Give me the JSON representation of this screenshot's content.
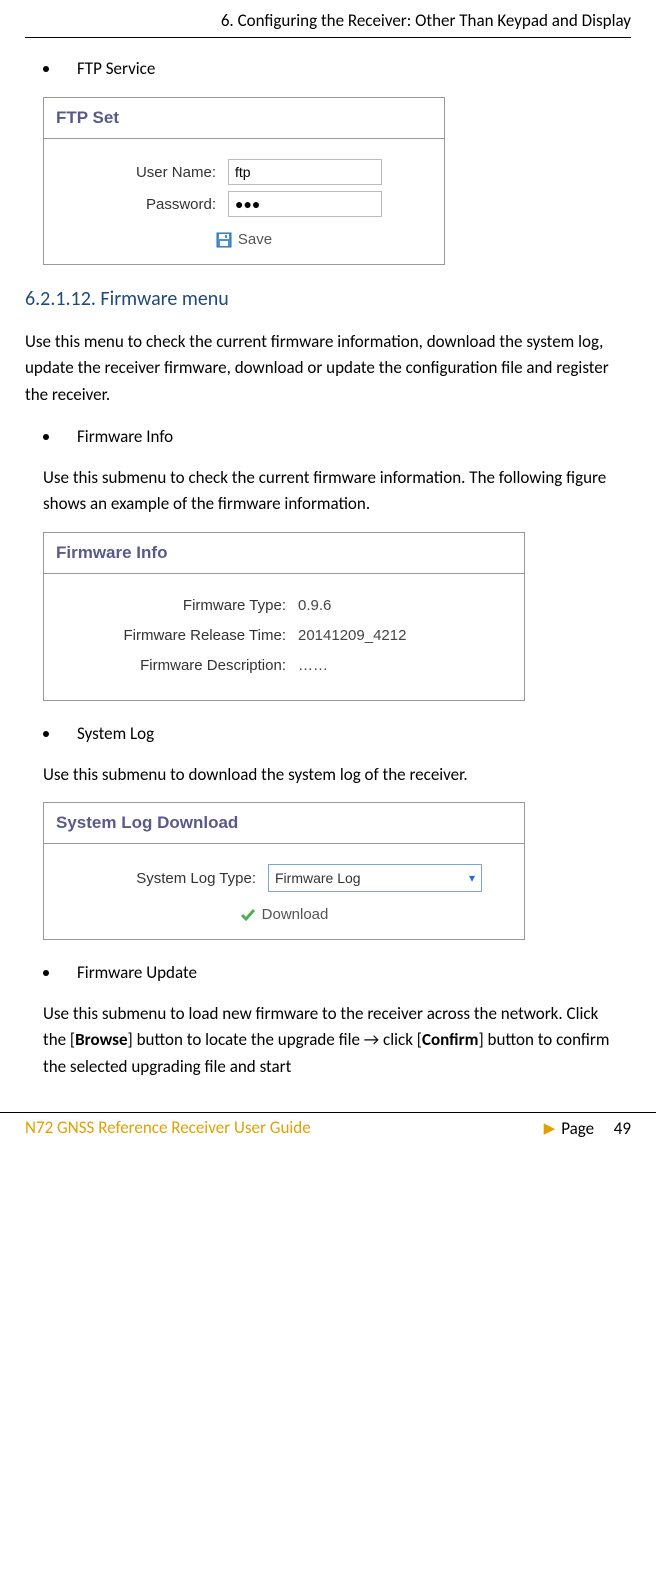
{
  "header": {
    "title": "6. Configuring the Receiver: Other Than Keypad and Display"
  },
  "bullets": {
    "ftp_service": "FTP Service",
    "firmware_info": "Firmware Info",
    "system_log": "System Log",
    "firmware_update": "Firmware Update"
  },
  "ftp_panel": {
    "title": "FTP Set",
    "username_label": "User Name:",
    "username_value": "ftp",
    "password_label": "Password:",
    "password_value": "●●●",
    "save_label": "Save"
  },
  "section_612": {
    "number": "6.2.1.12.",
    "title": "Firmware menu",
    "desc": "Use this menu to check the current firmware information, download the system log, update the receiver firmware, download or update the configuration file and register the receiver."
  },
  "firmware_info_desc": "Use this submenu to check the current firmware information. The following figure shows an example of the firmware information.",
  "firmware_panel": {
    "title": "Firmware Info",
    "type_label": "Firmware Type:",
    "type_value": "0.9.6",
    "release_label": "Firmware Release Time:",
    "release_value": "20141209_4212",
    "desc_label": "Firmware Description:",
    "desc_value": "……"
  },
  "system_log_desc": "Use this submenu to download the system log of the receiver.",
  "syslog_panel": {
    "title": "System Log Download",
    "type_label": "System Log Type:",
    "type_value": "Firmware Log",
    "download_label": "Download"
  },
  "firmware_update_desc_parts": {
    "p1": "Use this submenu to load new firmware to the receiver across the network. Click the [",
    "browse": "Browse",
    "p2": "] button to locate the upgrade file → click [",
    "confirm": "Confirm",
    "p3": "] button to confirm the selected upgrading file and start"
  },
  "footer": {
    "left": "N72 GNSS Reference Receiver User Guide",
    "page_label": "Page",
    "page_num": "49"
  }
}
